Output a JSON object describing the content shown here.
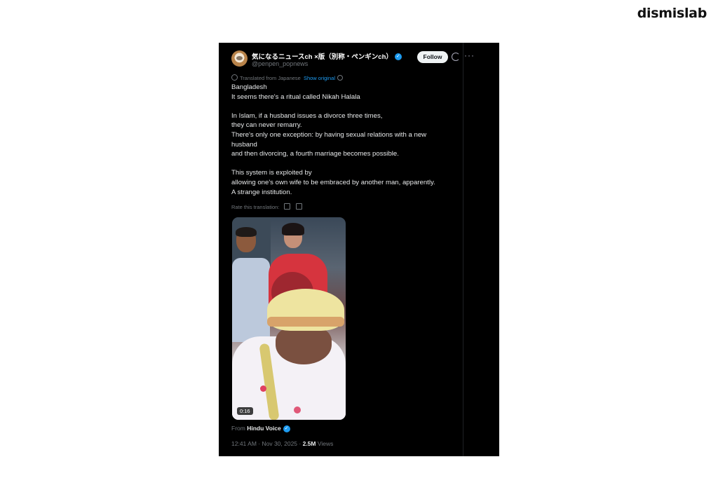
{
  "brand": "dismislab",
  "tweet": {
    "display_name": "気になるニュースch ×版（別称・ペンギンch）",
    "handle": "@penpen_popnews",
    "follow_label": "Follow",
    "translated_label": "Translated from Japanese",
    "show_original_label": "Show original",
    "body_lines": [
      "Bangladesh",
      "It seems there's a ritual called Nikah Halala",
      "",
      "In Islam, if a husband issues a divorce three times,",
      "they can never remarry.",
      "There's only one exception: by having sexual relations with a new",
      "husband",
      "and then divorcing, a fourth marriage becomes possible.",
      "",
      "This system is exploited by",
      "allowing one's own wife to be embraced by another man, apparently.",
      "A strange institution."
    ],
    "rate_label": "Rate this translation:",
    "video_duration": "0:16",
    "from_prefix": "From",
    "from_source": "Hindu Voice",
    "timestamp": "12:41 AM · Nov 30, 2025 · ",
    "views_count": "2.5M",
    "views_label": " Views"
  },
  "icons": {
    "verified": "verified-badge-icon",
    "grok": "grok-icon",
    "more": "more-options-icon"
  },
  "colors": {
    "accent": "#1d9bf0",
    "background": "#000000",
    "text": "#e7e9ea",
    "muted": "#71767b"
  }
}
